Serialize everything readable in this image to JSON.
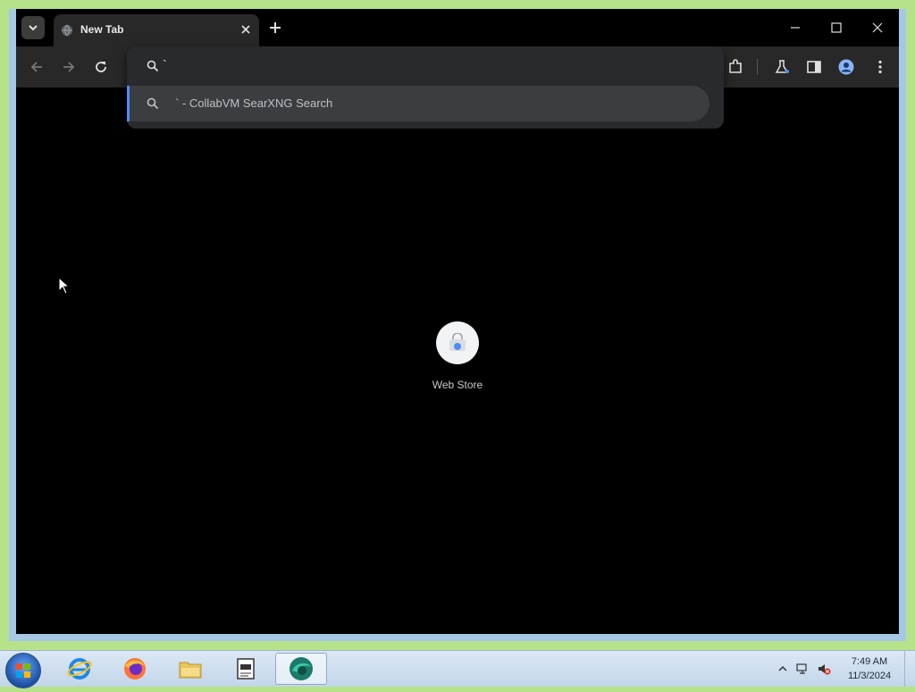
{
  "browser": {
    "tab": {
      "title": "New Tab"
    },
    "omnibox": {
      "query": "`",
      "suggestion": "` - CollabVM SearXNG Search"
    },
    "shortcut": {
      "label": "Web Store"
    }
  },
  "taskbar": {
    "apps": [
      "internet-explorer",
      "firefox",
      "file-explorer",
      "notepad-window",
      "active-browser"
    ],
    "clock": {
      "time": "7:49 AM",
      "date": "11/3/2024"
    }
  },
  "colors": {
    "desktop": "#b6e38a",
    "window_border": "#a7c7e7",
    "tab_bg": "#282828",
    "suggestion_accent": "#4c8df6"
  }
}
